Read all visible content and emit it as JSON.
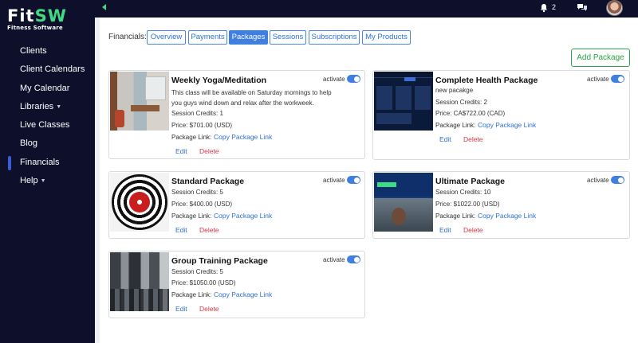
{
  "logo": {
    "main_a": "Fit",
    "main_b": "SW",
    "sub": "Fitness Software"
  },
  "sidebar": {
    "items": [
      {
        "label": "Clients",
        "caret": false,
        "active": false
      },
      {
        "label": "Client Calendars",
        "caret": false,
        "active": false
      },
      {
        "label": "My Calendar",
        "caret": false,
        "active": false
      },
      {
        "label": "Libraries",
        "caret": true,
        "active": false
      },
      {
        "label": "Live Classes",
        "caret": false,
        "active": false
      },
      {
        "label": "Blog",
        "caret": false,
        "active": false
      },
      {
        "label": "Financials",
        "caret": false,
        "active": true
      },
      {
        "label": "Help",
        "caret": true,
        "active": false
      }
    ]
  },
  "topbar": {
    "notification_count": "2",
    "icons": [
      "collapse-arrow-icon",
      "bell-icon",
      "chat-icon",
      "avatar"
    ]
  },
  "financials": {
    "label": "Financials:",
    "tabs": [
      {
        "label": "Overview",
        "active": false
      },
      {
        "label": "Payments",
        "active": false
      },
      {
        "label": "Packages",
        "active": true
      },
      {
        "label": "Sessions",
        "active": false
      },
      {
        "label": "Subscriptions",
        "active": false
      },
      {
        "label": "My Products",
        "active": false
      }
    ],
    "add_button": "Add Package"
  },
  "common": {
    "activate": "activate",
    "package_link": "Package Link:",
    "copy_link": "Copy Package Link",
    "edit": "Edit",
    "delete": "Delete"
  },
  "packages": [
    {
      "title": "Weekly Yoga/Meditation",
      "description": "This class will be available on Saturday mornings to help you guys wind down and relax after the workweek.",
      "credits": "Session Credits: 1",
      "price": "Price: $701.00 (USD)",
      "active": true
    },
    {
      "title": "Complete Health Package",
      "description": "new pacakge",
      "credits": "Session Credits: 2",
      "price": "Price: CA$722.00 (CAD)",
      "active": true
    },
    {
      "title": "Standard Package",
      "credits": "Session Credits: 5",
      "price": "Price: $400.00 (USD)",
      "active": true
    },
    {
      "title": "Ultimate Package",
      "credits": "Session Credits: 10",
      "price": "Price: $1022.00 (USD)",
      "active": true
    },
    {
      "title": "Group Training Package",
      "credits": "Session Credits: 5",
      "price": "Price: $1050.00 (USD)",
      "active": true
    }
  ],
  "colors": {
    "sidebar_bg": "#0d0f2b",
    "accent_blue": "#3f7fe0",
    "brand_green": "#3ddc84",
    "delete_red": "#dc3545",
    "add_green": "#28a745"
  }
}
